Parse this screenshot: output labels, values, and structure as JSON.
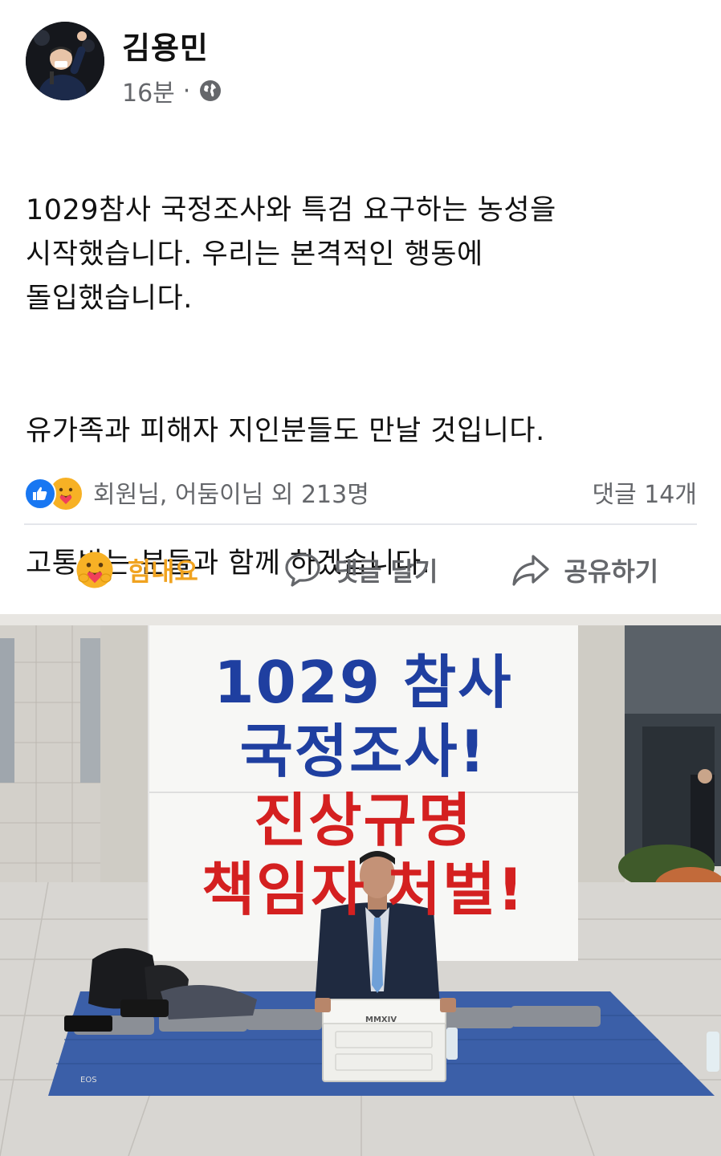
{
  "post": {
    "author": "김용민",
    "time": "16분",
    "separator": "·",
    "privacy_icon": "globe-icon",
    "paragraphs": [
      "1029참사 국정조사와 특검 요구하는 농성을\n시작했습니다. 우리는 본격적인 행동에\n돌입했습니다.",
      "유가족과 피해자 지인분들도 만날 것입니다.",
      "고통받는 분들과 함께 하겠습니다."
    ]
  },
  "reactions": {
    "icons": [
      "like-icon",
      "care-icon"
    ],
    "summary": "회원님, 어둠이님 외 213명",
    "comments": "댓글 14개"
  },
  "actions": {
    "care_label": "힘내요",
    "comment_label": "댓글 달기",
    "share_label": "공유하기"
  },
  "photo": {
    "banner_lines": [
      "1029 참사",
      "국정조사!",
      "진상규명",
      "책임자 처벌!"
    ],
    "banner_colors": [
      "#1f3fa0",
      "#1f3fa0",
      "#d42020",
      "#d42020"
    ],
    "box_label": "MMXIV",
    "camera_label": "EOS"
  }
}
